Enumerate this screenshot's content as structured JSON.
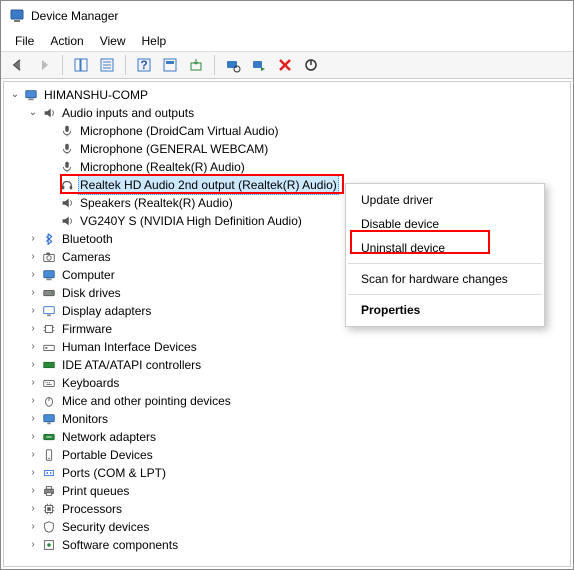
{
  "title": "Device Manager",
  "menu": {
    "file": "File",
    "action": "Action",
    "view": "View",
    "help": "Help"
  },
  "tree": {
    "root": "HIMANSHU-COMP",
    "audio": {
      "cat": "Audio inputs and outputs",
      "items": {
        "mic_droid": "Microphone (DroidCam Virtual Audio)",
        "mic_gen": "Microphone (GENERAL WEBCAM)",
        "mic_realtek": "Microphone (Realtek(R) Audio)",
        "realtek_2nd": "Realtek HD Audio 2nd output (Realtek(R) Audio)",
        "speakers": "Speakers (Realtek(R) Audio)",
        "vg240y": "VG240Y S (NVIDIA High Definition Audio)"
      }
    },
    "cats": {
      "bluetooth": "Bluetooth",
      "cameras": "Cameras",
      "computer": "Computer",
      "disk": "Disk drives",
      "display": "Display adapters",
      "firmware": "Firmware",
      "hid": "Human Interface Devices",
      "ide": "IDE ATA/ATAPI controllers",
      "keyboards": "Keyboards",
      "mice": "Mice and other pointing devices",
      "monitors": "Monitors",
      "network": "Network adapters",
      "portable": "Portable Devices",
      "ports": "Ports (COM & LPT)",
      "printq": "Print queues",
      "processors": "Processors",
      "security": "Security devices",
      "software": "Software components"
    }
  },
  "context_menu": {
    "update": "Update driver",
    "disable": "Disable device",
    "uninstall": "Uninstall device",
    "scan": "Scan for hardware changes",
    "properties": "Properties"
  }
}
